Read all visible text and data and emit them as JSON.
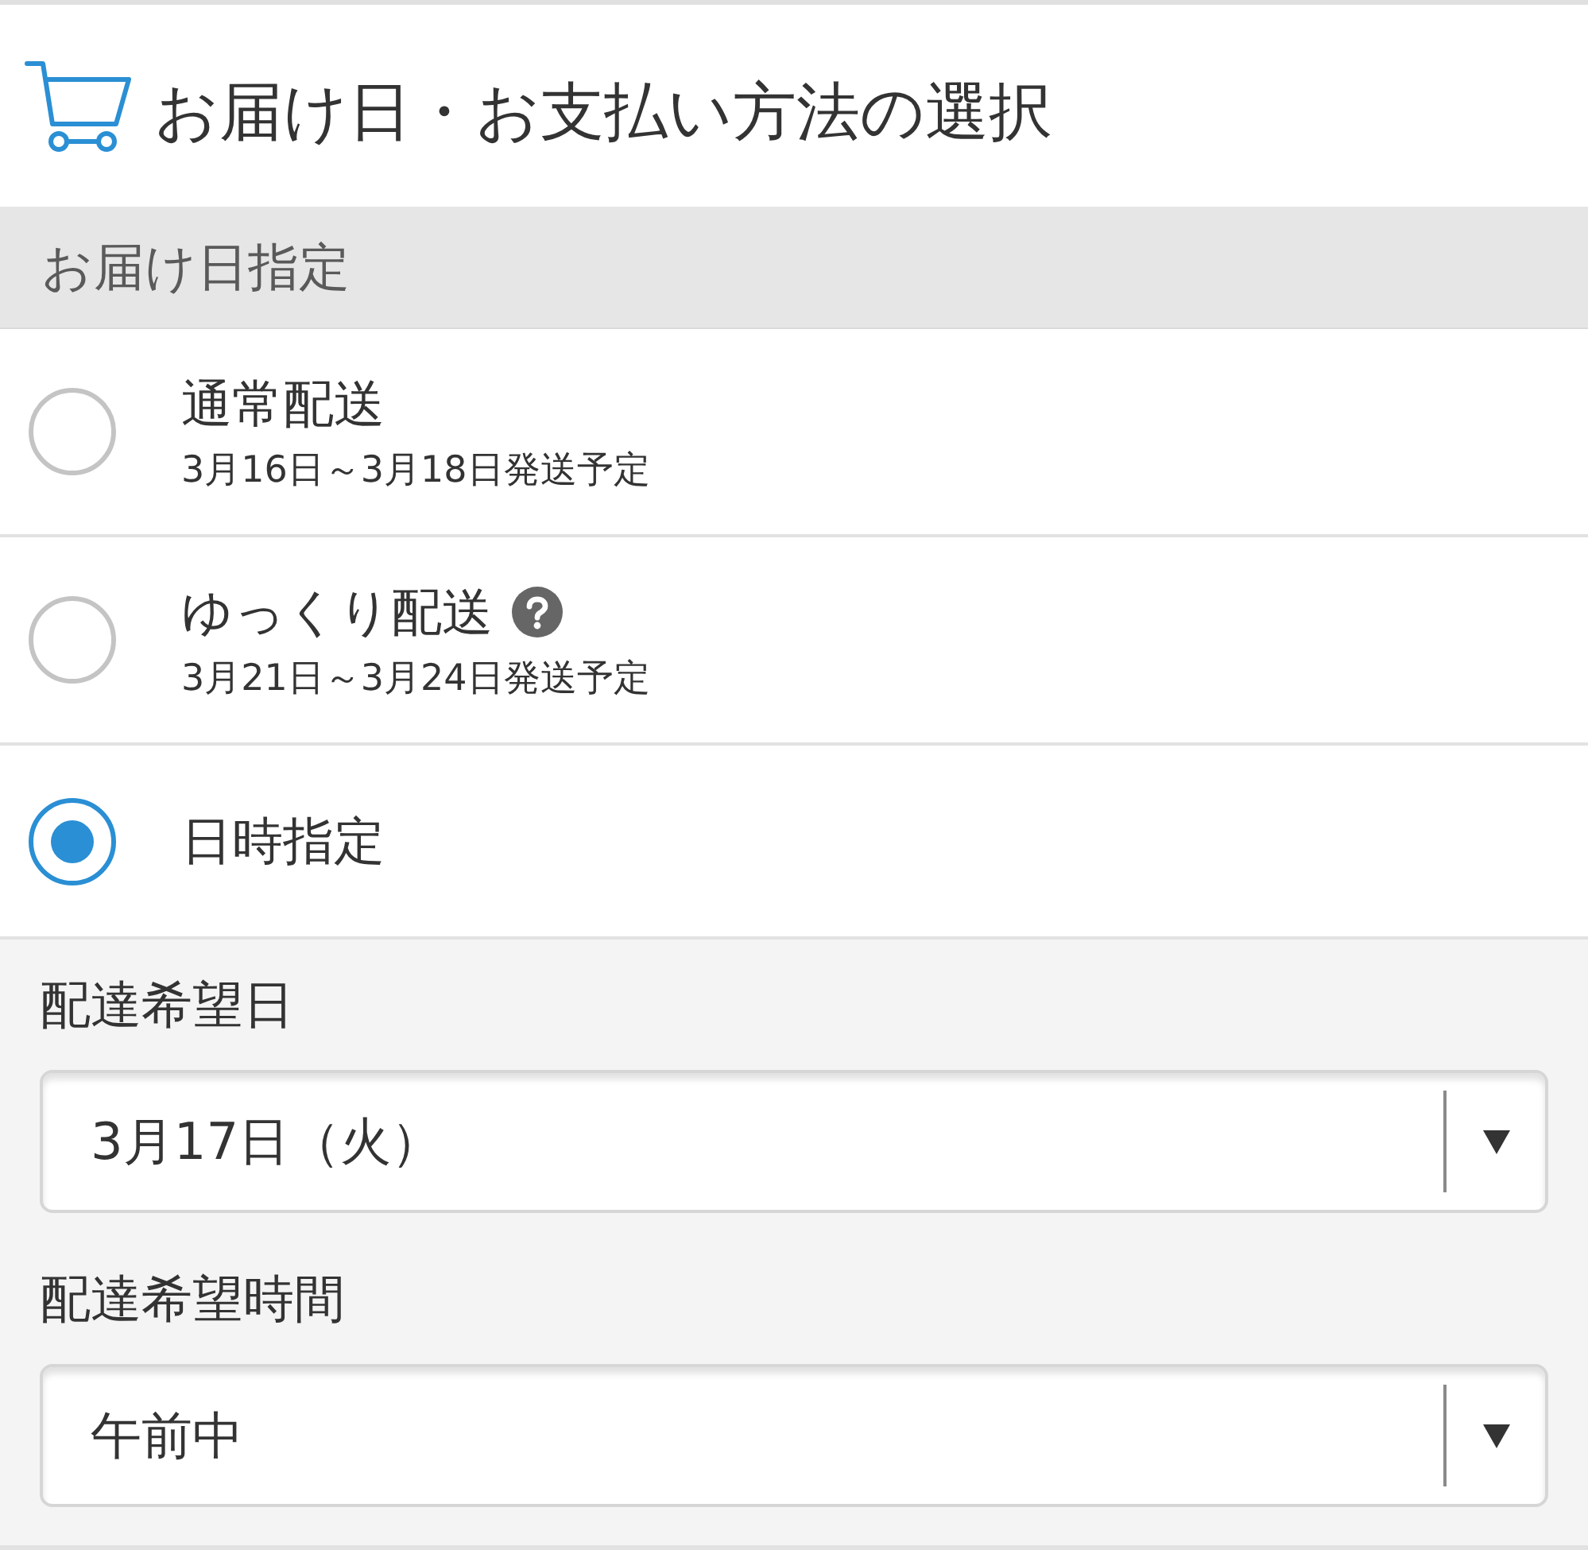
{
  "header": {
    "title": "お届け日・お支払い方法の選択"
  },
  "section": {
    "title": "お届け日指定"
  },
  "delivery_options": [
    {
      "label": "通常配送",
      "note": "3月16日～3月18日発送予定",
      "help": false,
      "selected": false
    },
    {
      "label": "ゆっくり配送",
      "note": "3月21日～3月24日発送予定",
      "help": true,
      "selected": false
    },
    {
      "label": "日時指定",
      "help": false,
      "selected": true
    }
  ],
  "delivery_preferences": [
    {
      "label": "配達希望日",
      "value": "3月17日（火）"
    },
    {
      "label": "配達希望時間",
      "value": "午前中"
    }
  ]
}
